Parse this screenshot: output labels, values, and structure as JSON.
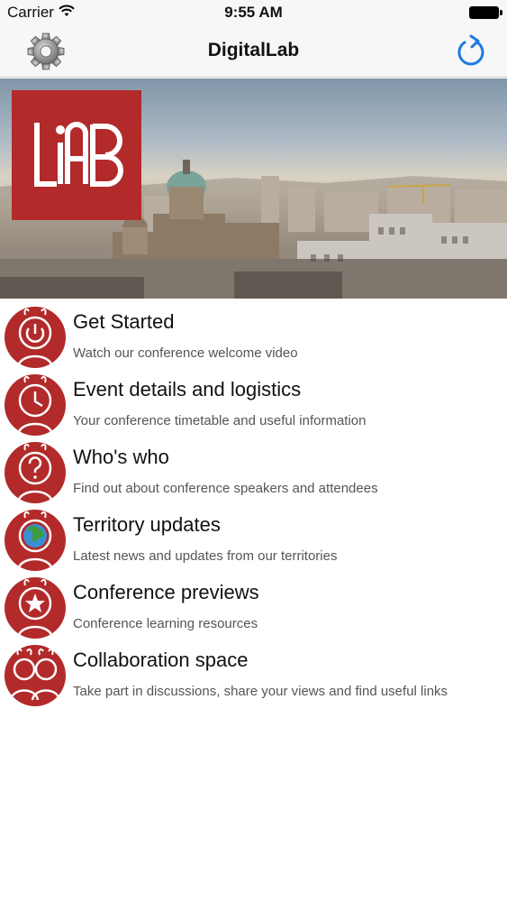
{
  "status_bar": {
    "carrier": "Carrier",
    "time": "9:55 AM",
    "wifi_icon": "wifi-icon",
    "battery_icon": "battery-icon"
  },
  "nav": {
    "title": "DigitalLab",
    "left_icon": "gear-icon",
    "right_icon": "refresh-icon"
  },
  "hero": {
    "logo_text": "LiAB",
    "logo_color": "#b22a2a"
  },
  "colors": {
    "accent": "#1e7be0",
    "brand_red": "#b22a2a"
  },
  "menu": [
    {
      "title": "Get Started",
      "subtitle": "Watch our conference welcome video",
      "icon": "power-icon"
    },
    {
      "title": "Event details and logistics",
      "subtitle": "Your conference timetable and useful information",
      "icon": "clock-icon"
    },
    {
      "title": "Who's who",
      "subtitle": "Find out about conference speakers and attendees",
      "icon": "question-icon"
    },
    {
      "title": "Territory updates",
      "subtitle": "Latest news and updates from our territories",
      "icon": "globe-icon"
    },
    {
      "title": "Conference previews",
      "subtitle": "Conference learning resources",
      "icon": "star-icon"
    },
    {
      "title": "Collaboration space",
      "subtitle": "Take part in discussions, share your views and find useful links",
      "icon": "people-icon"
    }
  ]
}
